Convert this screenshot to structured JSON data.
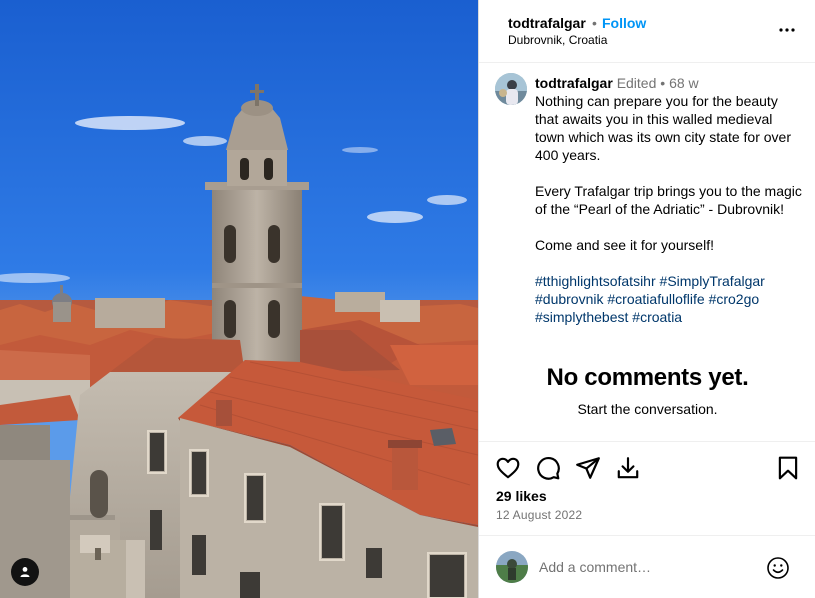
{
  "post": {
    "username": "todtrafalgar",
    "follow_label": "Follow",
    "separator": "•",
    "location": "Dubrovnik, Croatia",
    "more_icon": "more-horizontal-icon"
  },
  "caption": {
    "username": "todtrafalgar",
    "edited": "Edited",
    "separator": "•",
    "age": "68 w",
    "paragraphs": [
      "Nothing can prepare you for the beauty that awaits you in this walled medieval town which was its own city state for over 400 years.",
      "Every Trafalgar trip brings you to the magic of the “Pearl of the Adriatic” - Dubrovnik!",
      "Come and see it for yourself!"
    ],
    "hashtags": [
      "#tthighlightsofatsihr",
      "#SimplyTrafalgar",
      "#dubrovnik",
      "#croatiafulloflife",
      "#cro2go",
      "#simplythebest",
      "#croatia"
    ]
  },
  "comments": {
    "empty_title": "No comments yet.",
    "empty_subtitle": "Start the conversation."
  },
  "actions": {
    "icons": [
      "heart-icon",
      "comment-icon",
      "share-icon",
      "download-icon",
      "bookmark-icon"
    ],
    "likes": "29 likes",
    "date": "12 August 2022"
  },
  "add_comment": {
    "placeholder": "Add a comment…",
    "emoji_icon": "smiley-icon"
  },
  "photo": {
    "tag_icon": "user-tag-icon"
  }
}
